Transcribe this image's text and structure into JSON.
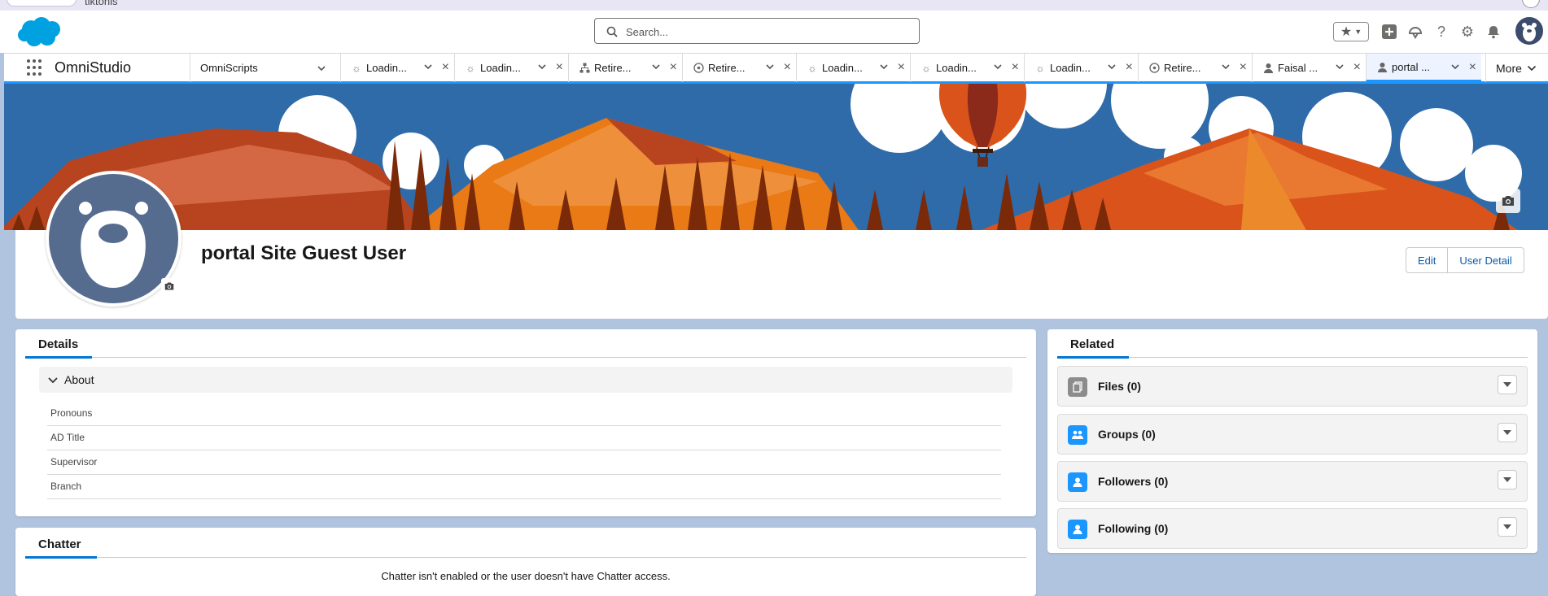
{
  "top_strip": {
    "text": "tiktonis"
  },
  "header": {
    "search_placeholder": "Search...",
    "icons": [
      "favorites-star-icon",
      "add-icon",
      "trailhead-icon",
      "help-icon",
      "setup-gear-icon",
      "notifications-bell-icon"
    ]
  },
  "nav": {
    "app_name": "OmniStudio",
    "object_tab": "OmniScripts",
    "tabs": [
      {
        "label": "Loadin...",
        "icon": "loading-icon"
      },
      {
        "label": "Loadin...",
        "icon": "loading-icon"
      },
      {
        "label": "Retire...",
        "icon": "hierarchy-icon"
      },
      {
        "label": "Retire...",
        "icon": "omniscript-icon"
      },
      {
        "label": "Loadin...",
        "icon": "loading-icon"
      },
      {
        "label": "Loadin...",
        "icon": "loading-icon"
      },
      {
        "label": "Loadin...",
        "icon": "loading-icon"
      },
      {
        "label": "Retire...",
        "icon": "omniscript-icon"
      },
      {
        "label": "Faisal ...",
        "icon": "user-icon"
      },
      {
        "label": "portal ...",
        "icon": "user-icon"
      }
    ],
    "more_label": "More"
  },
  "profile": {
    "name": "portal Site Guest User",
    "edit_label": "Edit",
    "user_detail_label": "User Detail"
  },
  "details": {
    "tab_label": "Details",
    "section_label": "About",
    "fields": [
      "Pronouns",
      "AD Title",
      "Supervisor",
      "Branch"
    ]
  },
  "chatter": {
    "tab_label": "Chatter",
    "message": "Chatter isn't enabled or the user doesn't have Chatter access."
  },
  "related": {
    "tab_label": "Related",
    "items": [
      {
        "label": "Files (0)",
        "icon": "files-icon",
        "color": "#8c8c8c"
      },
      {
        "label": "Groups (0)",
        "icon": "groups-icon",
        "color": "#1b96ff"
      },
      {
        "label": "Followers (0)",
        "icon": "followers-icon",
        "color": "#1b96ff"
      },
      {
        "label": "Following (0)",
        "icon": "following-icon",
        "color": "#1b96ff"
      }
    ]
  },
  "colors": {
    "brand_blue": "#0176d3",
    "tab_accent": "#1b96ff",
    "link": "#0b5cab",
    "page_bg": "#b0c4df"
  }
}
